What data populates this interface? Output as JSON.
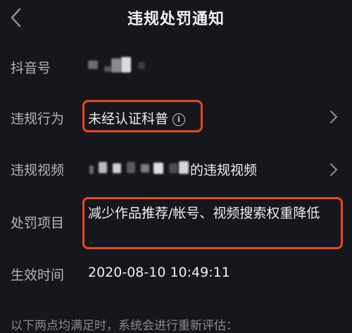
{
  "header": {
    "title": "违规处罚通知",
    "back_icon": "back-chevron-icon"
  },
  "rows": {
    "account": {
      "label": "抖音号"
    },
    "behavior": {
      "label": "违规行为",
      "value": "未经认证科普",
      "info_icon": "i"
    },
    "video": {
      "label": "违规视频",
      "value_suffix": "的违规视频"
    },
    "penalty": {
      "label": "处罚项目",
      "value": "减少作品推荐/帐号、视频搜索权重降低"
    },
    "effective_time": {
      "label": "生效时间",
      "value": "2020-08-10 10:49:11"
    }
  },
  "footer": {
    "note": "以下两点均满足时，系统会进行重新评估："
  },
  "colors": {
    "background": "#16171d",
    "highlight": "#e8491d",
    "label": "#b4b5ba",
    "value": "#eeeef0"
  }
}
